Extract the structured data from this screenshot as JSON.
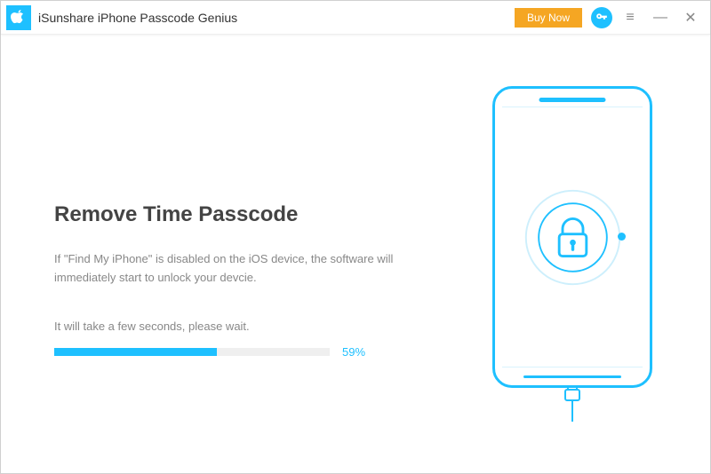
{
  "header": {
    "app_title": "iSunshare iPhone Passcode Genius",
    "buy_now_label": "Buy Now"
  },
  "main": {
    "title": "Remove Time Passcode",
    "description": "If \"Find My iPhone\" is disabled on the iOS device, the software will immediately start to unlock your devcie.",
    "wait_text": "It will take a few seconds, please wait.",
    "progress_percent": 59,
    "progress_label": "59%"
  },
  "colors": {
    "accent": "#1ec0ff",
    "buy": "#f5a623"
  }
}
